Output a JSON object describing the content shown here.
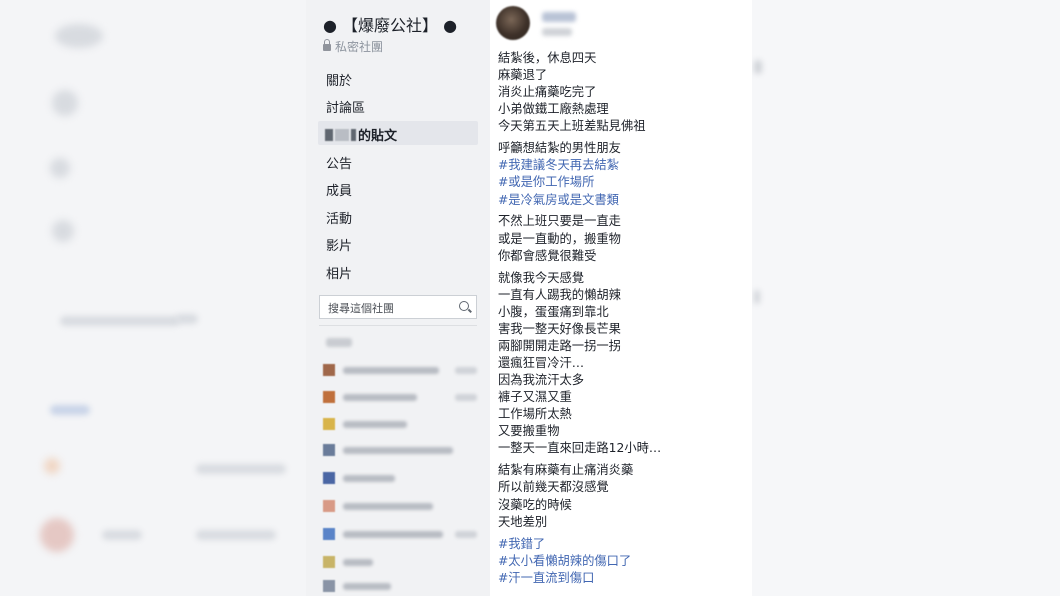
{
  "group": {
    "name": "● 【爆廢公社】 ●",
    "privacy": "私密社團"
  },
  "nav": {
    "items": [
      "關於",
      "討論區",
      "的貼文",
      "公告",
      "成員",
      "活動",
      "影片",
      "相片"
    ],
    "active_index": 2
  },
  "search": {
    "placeholder": "搜尋這個社團"
  },
  "post": {
    "paragraphs": [
      {
        "lines": [
          "結紮後，休息四天",
          "麻藥退了",
          "消炎止痛藥吃完了",
          "小弟做鐵工廠熱處理",
          "今天第五天上班差點見佛祖"
        ]
      },
      {
        "lines": [
          "呼籲想結紮的男性朋友",
          "#我建議冬天再去結紮",
          "#或是你工作場所",
          "#是冷氣房或是文書類"
        ]
      },
      {
        "lines": [
          "不然上班只要是一直走",
          "或是一直動的，搬重物",
          "你都會感覺很難受"
        ]
      },
      {
        "lines": [
          "就像我今天感覺",
          "一直有人踢我的懶胡辣",
          "小腹，蛋蛋痛到靠北",
          "害我一整天好像長芒果",
          "兩腳開開走路一拐一拐",
          "還瘋狂冒冷汗…",
          "因為我流汗太多",
          "褲子又濕又重",
          "工作場所太熱",
          "又要搬重物",
          "一整天一直來回走路12小時…"
        ]
      },
      {
        "lines": [
          "結紮有麻藥有止痛消炎藥",
          "所以前幾天都沒感覺",
          "沒藥吃的時候",
          "天地差別"
        ]
      },
      {
        "lines": [
          "#我錯了",
          "#太小看懶胡辣的傷口了",
          "#汗一直流到傷口"
        ]
      }
    ]
  },
  "colors": {
    "hashtag": "#4267b2",
    "text": "#1d2129",
    "nav_background": "#f1f2f4"
  }
}
